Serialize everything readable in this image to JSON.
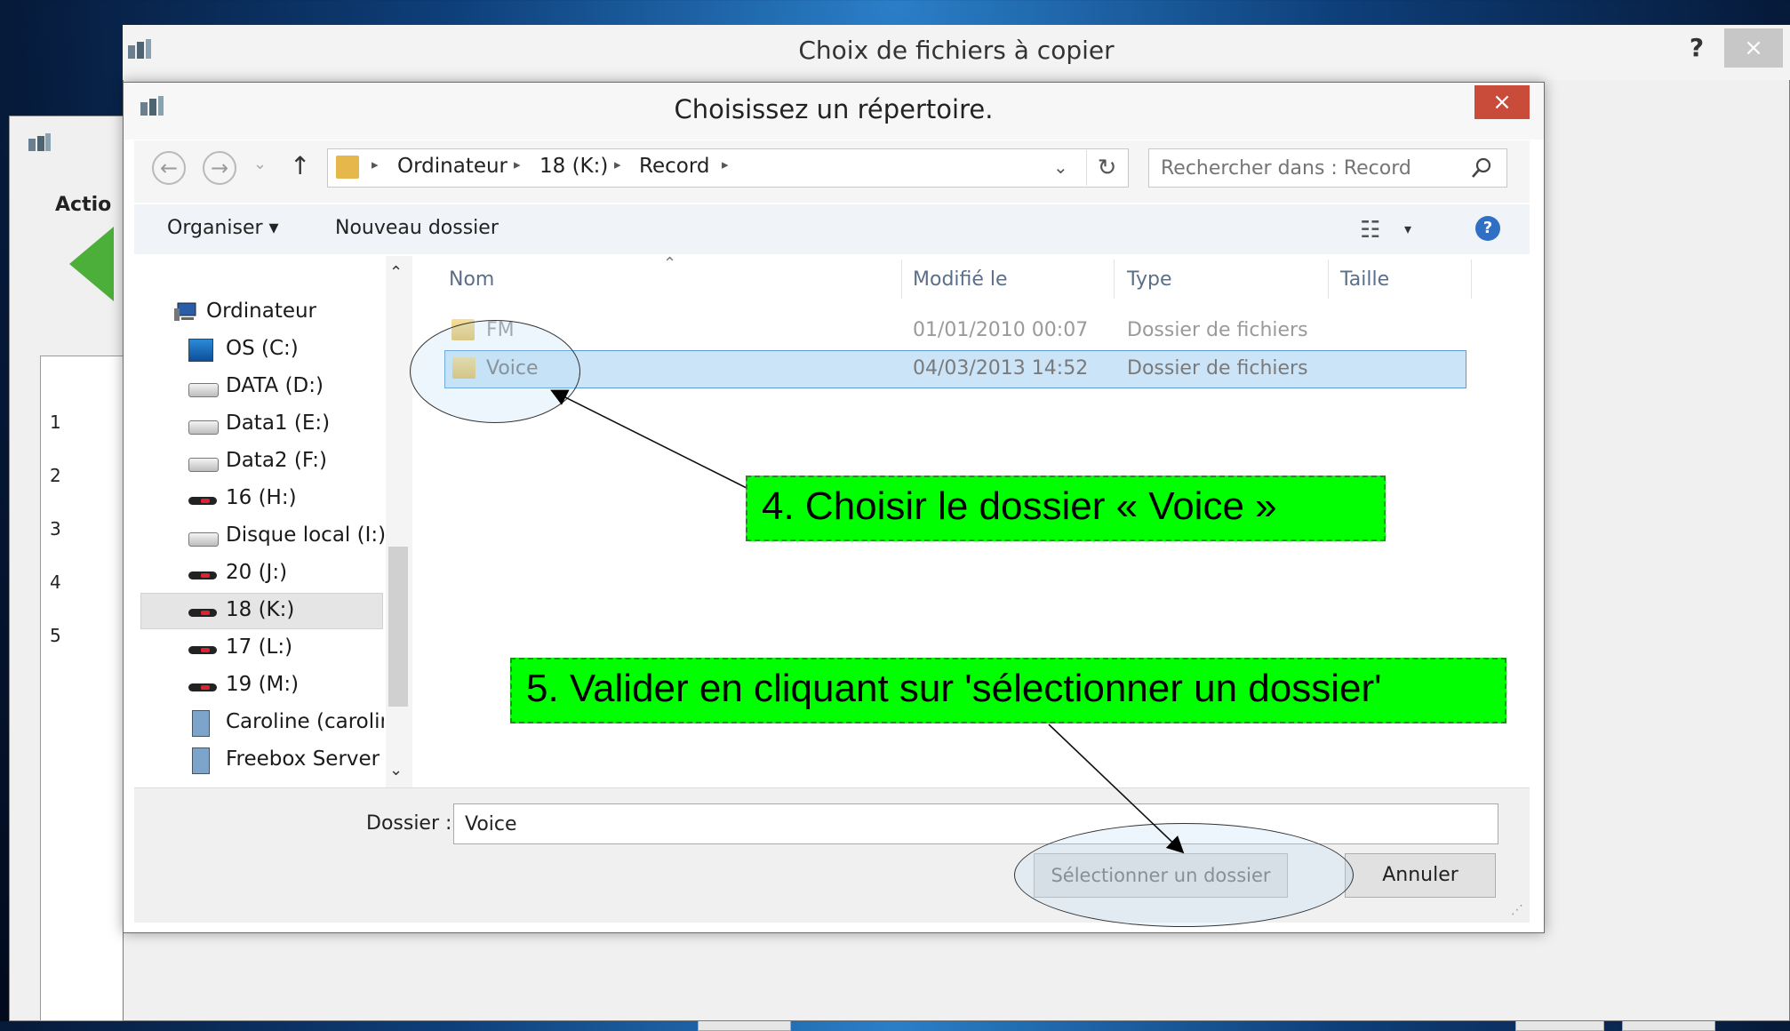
{
  "background_app": {
    "actions_label": "Actio",
    "row_numbers": [
      "1",
      "2",
      "3",
      "4",
      "5"
    ]
  },
  "outer_dialog": {
    "title": "Choix de fichiers à copier",
    "help": "?",
    "close": "×"
  },
  "inner_dialog": {
    "title": "Choisissez un répertoire.",
    "close": "×"
  },
  "address_bar": {
    "back": "←",
    "forward": "→",
    "recent": "⌄",
    "up": "↑",
    "breadcrumbs": [
      "Ordinateur",
      "18 (K:)",
      "Record"
    ],
    "separator": "▸",
    "dropdown": "⌄",
    "refresh": "↻"
  },
  "search": {
    "placeholder": "Rechercher dans : Record",
    "icon": "search-icon"
  },
  "toolbar": {
    "organize": "Organiser ▾",
    "new_folder": "Nouveau dossier",
    "view_icon": "☷",
    "view_drop": "▾",
    "help": "?"
  },
  "nav_pane": {
    "scroll_up": "⌃",
    "scroll_down": "⌄",
    "items": [
      {
        "label": "Ordinateur",
        "icon": "computer-icon"
      },
      {
        "label": "OS (C:)",
        "icon": "os-drive-icon"
      },
      {
        "label": "DATA (D:)",
        "icon": "drive-icon"
      },
      {
        "label": "Data1 (E:)",
        "icon": "drive-icon"
      },
      {
        "label": "Data2 (F:)",
        "icon": "drive-icon"
      },
      {
        "label": "16 (H:)",
        "icon": "usb-drive-icon"
      },
      {
        "label": "Disque local (I:)",
        "icon": "drive-icon"
      },
      {
        "label": "20 (J:)",
        "icon": "usb-drive-icon"
      },
      {
        "label": "18 (K:)",
        "icon": "usb-drive-icon",
        "selected": true
      },
      {
        "label": "17 (L:)",
        "icon": "usb-drive-icon"
      },
      {
        "label": "19 (M:)",
        "icon": "usb-drive-icon"
      },
      {
        "label": "Caroline (carolin",
        "icon": "network-computer-icon"
      },
      {
        "label": "Freebox Server",
        "icon": "network-computer-icon"
      }
    ]
  },
  "file_list": {
    "columns": [
      "Nom",
      "Modifié le",
      "Type",
      "Taille"
    ],
    "sort_indicator": "⌃",
    "rows": [
      {
        "name": "FM",
        "modified": "01/01/2010 00:07",
        "type": "Dossier de fichiers",
        "size": ""
      },
      {
        "name": "Voice",
        "modified": "04/03/2013 14:52",
        "type": "Dossier de fichiers",
        "size": "",
        "selected": true
      }
    ]
  },
  "bottom": {
    "folder_label": "Dossier :",
    "folder_value": "Voice",
    "select_button": "Sélectionner un dossier",
    "cancel_button": "Annuler",
    "grip": "⋰"
  },
  "annotations": {
    "step4": "4. Choisir le dossier « Voice »",
    "step5": "5. Valider en cliquant sur 'sélectionner un dossier'",
    "callout_color": "#00ff00"
  },
  "colors": {
    "close_red": "#c94b3a",
    "selection_blue": "#cce4f7",
    "help_blue": "#2f6fc4"
  }
}
